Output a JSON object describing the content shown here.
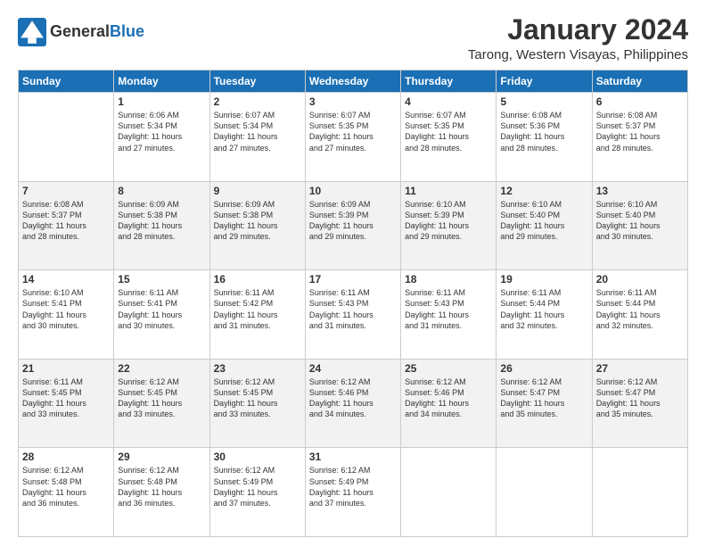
{
  "header": {
    "logo_general": "General",
    "logo_blue": "Blue",
    "main_title": "January 2024",
    "subtitle": "Tarong, Western Visayas, Philippines"
  },
  "calendar": {
    "columns": [
      "Sunday",
      "Monday",
      "Tuesday",
      "Wednesday",
      "Thursday",
      "Friday",
      "Saturday"
    ],
    "weeks": [
      [
        {
          "day": "",
          "info": ""
        },
        {
          "day": "1",
          "info": "Sunrise: 6:06 AM\nSunset: 5:34 PM\nDaylight: 11 hours\nand 27 minutes."
        },
        {
          "day": "2",
          "info": "Sunrise: 6:07 AM\nSunset: 5:34 PM\nDaylight: 11 hours\nand 27 minutes."
        },
        {
          "day": "3",
          "info": "Sunrise: 6:07 AM\nSunset: 5:35 PM\nDaylight: 11 hours\nand 27 minutes."
        },
        {
          "day": "4",
          "info": "Sunrise: 6:07 AM\nSunset: 5:35 PM\nDaylight: 11 hours\nand 28 minutes."
        },
        {
          "day": "5",
          "info": "Sunrise: 6:08 AM\nSunset: 5:36 PM\nDaylight: 11 hours\nand 28 minutes."
        },
        {
          "day": "6",
          "info": "Sunrise: 6:08 AM\nSunset: 5:37 PM\nDaylight: 11 hours\nand 28 minutes."
        }
      ],
      [
        {
          "day": "7",
          "info": "Sunrise: 6:08 AM\nSunset: 5:37 PM\nDaylight: 11 hours\nand 28 minutes."
        },
        {
          "day": "8",
          "info": "Sunrise: 6:09 AM\nSunset: 5:38 PM\nDaylight: 11 hours\nand 28 minutes."
        },
        {
          "day": "9",
          "info": "Sunrise: 6:09 AM\nSunset: 5:38 PM\nDaylight: 11 hours\nand 29 minutes."
        },
        {
          "day": "10",
          "info": "Sunrise: 6:09 AM\nSunset: 5:39 PM\nDaylight: 11 hours\nand 29 minutes."
        },
        {
          "day": "11",
          "info": "Sunrise: 6:10 AM\nSunset: 5:39 PM\nDaylight: 11 hours\nand 29 minutes."
        },
        {
          "day": "12",
          "info": "Sunrise: 6:10 AM\nSunset: 5:40 PM\nDaylight: 11 hours\nand 29 minutes."
        },
        {
          "day": "13",
          "info": "Sunrise: 6:10 AM\nSunset: 5:40 PM\nDaylight: 11 hours\nand 30 minutes."
        }
      ],
      [
        {
          "day": "14",
          "info": "Sunrise: 6:10 AM\nSunset: 5:41 PM\nDaylight: 11 hours\nand 30 minutes."
        },
        {
          "day": "15",
          "info": "Sunrise: 6:11 AM\nSunset: 5:41 PM\nDaylight: 11 hours\nand 30 minutes."
        },
        {
          "day": "16",
          "info": "Sunrise: 6:11 AM\nSunset: 5:42 PM\nDaylight: 11 hours\nand 31 minutes."
        },
        {
          "day": "17",
          "info": "Sunrise: 6:11 AM\nSunset: 5:43 PM\nDaylight: 11 hours\nand 31 minutes."
        },
        {
          "day": "18",
          "info": "Sunrise: 6:11 AM\nSunset: 5:43 PM\nDaylight: 11 hours\nand 31 minutes."
        },
        {
          "day": "19",
          "info": "Sunrise: 6:11 AM\nSunset: 5:44 PM\nDaylight: 11 hours\nand 32 minutes."
        },
        {
          "day": "20",
          "info": "Sunrise: 6:11 AM\nSunset: 5:44 PM\nDaylight: 11 hours\nand 32 minutes."
        }
      ],
      [
        {
          "day": "21",
          "info": "Sunrise: 6:11 AM\nSunset: 5:45 PM\nDaylight: 11 hours\nand 33 minutes."
        },
        {
          "day": "22",
          "info": "Sunrise: 6:12 AM\nSunset: 5:45 PM\nDaylight: 11 hours\nand 33 minutes."
        },
        {
          "day": "23",
          "info": "Sunrise: 6:12 AM\nSunset: 5:45 PM\nDaylight: 11 hours\nand 33 minutes."
        },
        {
          "day": "24",
          "info": "Sunrise: 6:12 AM\nSunset: 5:46 PM\nDaylight: 11 hours\nand 34 minutes."
        },
        {
          "day": "25",
          "info": "Sunrise: 6:12 AM\nSunset: 5:46 PM\nDaylight: 11 hours\nand 34 minutes."
        },
        {
          "day": "26",
          "info": "Sunrise: 6:12 AM\nSunset: 5:47 PM\nDaylight: 11 hours\nand 35 minutes."
        },
        {
          "day": "27",
          "info": "Sunrise: 6:12 AM\nSunset: 5:47 PM\nDaylight: 11 hours\nand 35 minutes."
        }
      ],
      [
        {
          "day": "28",
          "info": "Sunrise: 6:12 AM\nSunset: 5:48 PM\nDaylight: 11 hours\nand 36 minutes."
        },
        {
          "day": "29",
          "info": "Sunrise: 6:12 AM\nSunset: 5:48 PM\nDaylight: 11 hours\nand 36 minutes."
        },
        {
          "day": "30",
          "info": "Sunrise: 6:12 AM\nSunset: 5:49 PM\nDaylight: 11 hours\nand 37 minutes."
        },
        {
          "day": "31",
          "info": "Sunrise: 6:12 AM\nSunset: 5:49 PM\nDaylight: 11 hours\nand 37 minutes."
        },
        {
          "day": "",
          "info": ""
        },
        {
          "day": "",
          "info": ""
        },
        {
          "day": "",
          "info": ""
        }
      ]
    ]
  }
}
